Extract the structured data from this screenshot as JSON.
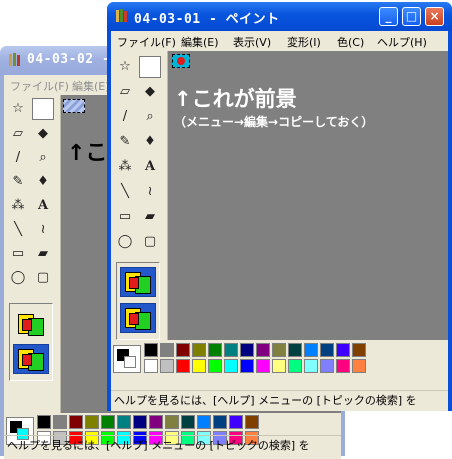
{
  "back_window": {
    "title": "04-03-02 - ",
    "menu": [
      "ファイル(F)",
      "編集(E)"
    ],
    "canvas_label": "↑これが背景",
    "status": "ヘルプを見るには、[ヘルプ] メニューの [トピックの検索] を"
  },
  "front_window": {
    "title": "04-03-01 - ペイント",
    "menu": [
      "ファイル(F)",
      "編集(E)",
      "表示(V)",
      "変形(I)",
      "色(C)",
      "ヘルプ(H)"
    ],
    "canvas_label": "↑これが前景",
    "canvas_sublabel": "（メニュー→編集→コピーしておく）",
    "status": "ヘルプを見るには、[ヘルプ] メニューの [トピックの検索] を",
    "buttons": {
      "minimize": "_",
      "maximize": "□",
      "close": "×"
    }
  },
  "tools": [
    "free-select",
    "rect-select",
    "eraser",
    "fill",
    "picker",
    "magnifier",
    "pencil",
    "brush",
    "airbrush",
    "text",
    "line",
    "curve",
    "rectangle",
    "polygon",
    "ellipse",
    "rounded-rect"
  ],
  "tool_glyphs": [
    "☆",
    "",
    "▱",
    "◆",
    "/",
    "⌕",
    "✎",
    "♦",
    "⁂",
    "A",
    "╲",
    "≀",
    "▭",
    "▰",
    "◯",
    "▢"
  ],
  "palette_top": [
    "#000000",
    "#808080",
    "#800000",
    "#808000",
    "#008000",
    "#008080",
    "#000080",
    "#800080",
    "#808040",
    "#004040",
    "#0080ff",
    "#004080",
    "#4000ff",
    "#804000"
  ],
  "palette_bottom": [
    "#ffffff",
    "#c0c0c0",
    "#ff0000",
    "#ffff00",
    "#00ff00",
    "#00ffff",
    "#0000ff",
    "#ff00ff",
    "#ffff80",
    "#00ff80",
    "#80ffff",
    "#8080ff",
    "#ff0080",
    "#ff8040"
  ]
}
